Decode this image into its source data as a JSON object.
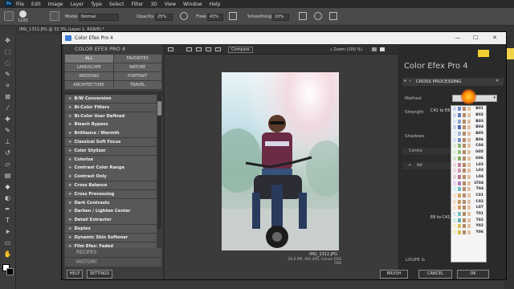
{
  "ps": {
    "menu": [
      "File",
      "Edit",
      "Image",
      "Layer",
      "Type",
      "Select",
      "Filter",
      "3D",
      "View",
      "Window",
      "Help"
    ],
    "logo": "Ps",
    "options": {
      "brush_size": "1100",
      "mode_label": "Mode:",
      "mode_value": "Normal",
      "opacity_label": "Opacity:",
      "opacity_value": "25%",
      "flow_label": "Flow:",
      "flow_value": "43%",
      "smoothing_label": "Smoothing:",
      "smoothing_value": "10%"
    },
    "doc_tab": "IMG_1312.JPG @ 33.3% (Layer 1, RGB/8) *"
  },
  "cef": {
    "window_title": "Color Efex Pro 4",
    "controls": {
      "minimize": "—",
      "maximize": "☐",
      "close": "✕"
    },
    "left_header": "COLOR EFEX PRO 4",
    "categories": [
      "ALL",
      "FAVORITES",
      "LANDSCAPE",
      "NATURE",
      "WEDDING",
      "PORTRAIT",
      "ARCHITECTURE",
      "TRAVEL"
    ],
    "filters": [
      "B/W Conversion",
      "Bi-Color Filters",
      "Bi-Color User Defined",
      "Bleach Bypass",
      "Brilliance / Warmth",
      "Classical Soft Focus",
      "Color Stylizer",
      "Colorize",
      "Contrast Color Range",
      "Contrast Only",
      "Cross Balance",
      "Cross Processing",
      "Dark Contrasts",
      "Darken / Lighten Center",
      "Detail Extractor",
      "Duplex",
      "Dynamic Skin Softener",
      "Film Efex: Faded",
      "Film Efex: Modern"
    ],
    "recipes": "RECIPES",
    "history": "HISTORY",
    "help_btn": "HELP",
    "settings_btn": "SETTINGS",
    "compare_btn": "Compare",
    "zoom": "Zoom (100 %)",
    "photo_caption": "IMG_1312.JPG",
    "photo_meta": "20.0 MP, ISO 200, Canon EOS 70D",
    "right_title": "Color Efex Pro",
    "right_version": "4",
    "section": "CROSS PROCESSING",
    "method_label": "Method",
    "strength_label": "Strength",
    "shadows_label": "Shadows",
    "control_points": "Contro",
    "add_label": "Ad",
    "loupe": "LOUPE &",
    "group1": "C41 to E6",
    "group2": "E6 to C41",
    "methods": [
      "B01",
      "B02",
      "B03",
      "B04",
      "B05",
      "B06",
      "C04",
      "G05",
      "G06",
      "L02",
      "L03",
      "L04",
      "LT04",
      "T04",
      "C01",
      "C02",
      "L07",
      "T01",
      "T02",
      "Y02",
      "Y06"
    ],
    "brush_btn": "BRUSH",
    "cancel_btn": "CANCEL",
    "ok_btn": "OK",
    "colors": {
      "accent": "#e8a000",
      "list_bg": "#f4f4f4",
      "panel": "#2a2a2a"
    }
  }
}
